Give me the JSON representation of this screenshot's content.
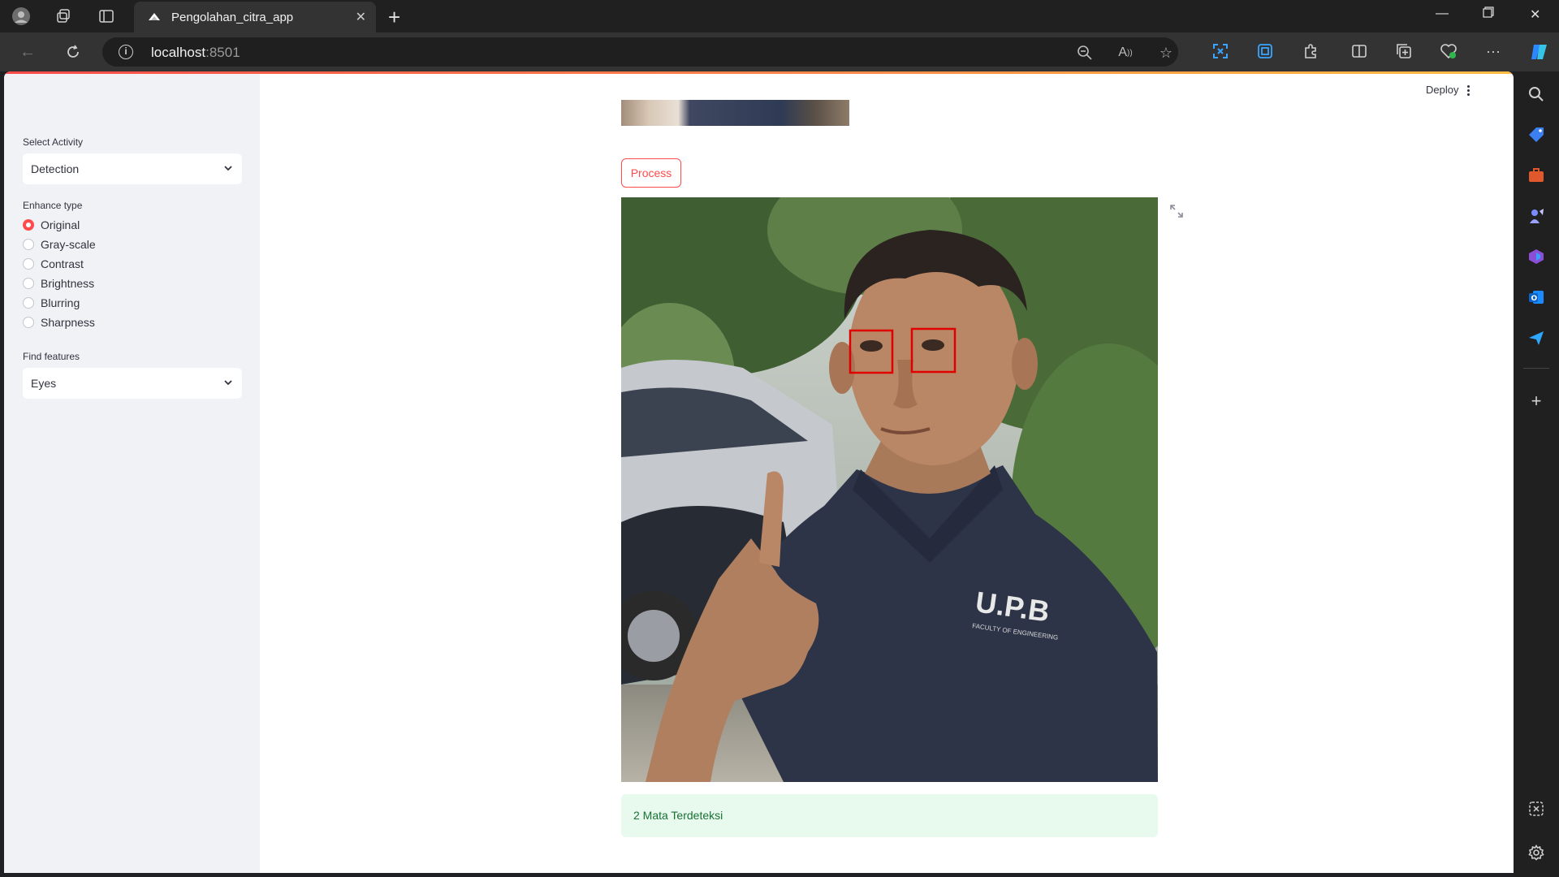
{
  "browser": {
    "tab_title": "Pengolahan_citra_app",
    "url_host": "localhost",
    "url_port": ":8501"
  },
  "sidebar": {
    "activity_label": "Select Activity",
    "activity_value": "Detection",
    "enhance_label": "Enhance type",
    "enhance_options": [
      "Original",
      "Gray-scale",
      "Contrast",
      "Brightness",
      "Blurring",
      "Sharpness"
    ],
    "enhance_selected": "Original",
    "features_label": "Find features",
    "features_value": "Eyes"
  },
  "main": {
    "deploy_label": "Deploy",
    "process_label": "Process",
    "shirt_text": "U.P.B",
    "shirt_subtext": "FACULTY OF ENGINEERING",
    "result_message": "2 Mata Terdeteksi",
    "detections": 2
  },
  "colors": {
    "accent": "#ff4b4b",
    "sidebar_bg": "#f0f2f6",
    "success_bg": "#e8f9ee",
    "success_text": "#177233",
    "detection_box": "#e00000"
  }
}
